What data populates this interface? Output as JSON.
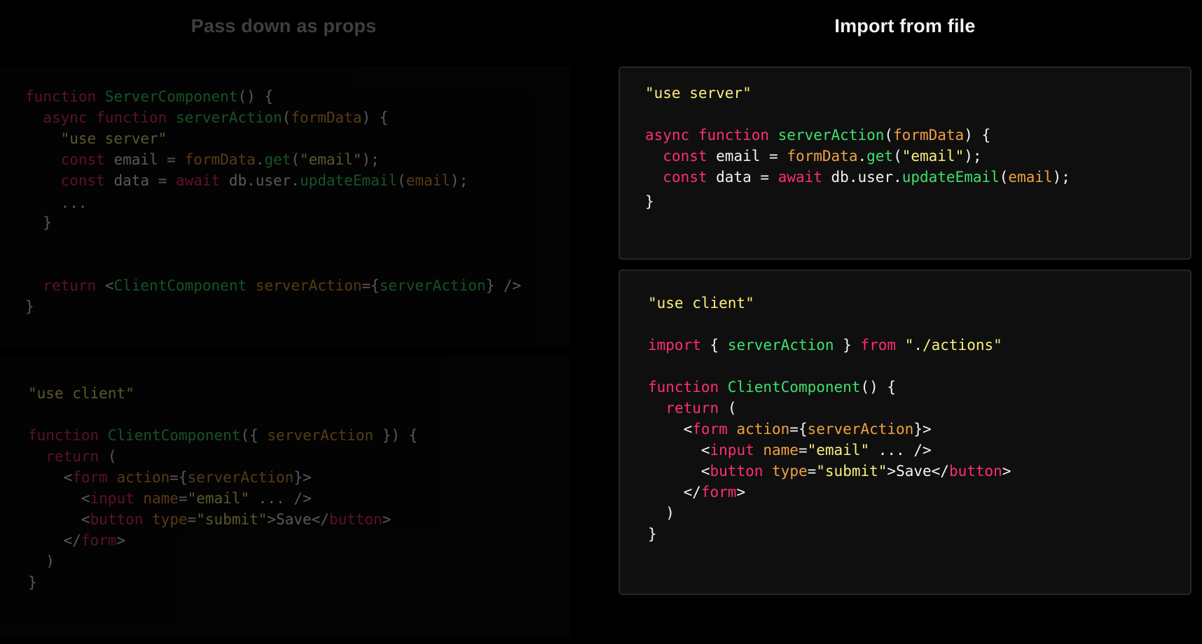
{
  "headings": {
    "left": "Pass down as props",
    "right": "Import from file"
  },
  "panels": {
    "left_server": {
      "lines": [
        [
          [
            "kw",
            "function "
          ],
          [
            "fn",
            "ServerComponent"
          ],
          [
            "pl",
            "() {"
          ]
        ],
        [
          [
            "pl",
            "  "
          ],
          [
            "kw",
            "async function "
          ],
          [
            "fn",
            "serverAction"
          ],
          [
            "pl",
            "("
          ],
          [
            "prm",
            "formData"
          ],
          [
            "pl",
            ") {"
          ]
        ],
        [
          [
            "pl",
            "    "
          ],
          [
            "str",
            "\"use server\""
          ]
        ],
        [
          [
            "pl",
            "    "
          ],
          [
            "kw",
            "const "
          ],
          [
            "pl",
            "email = "
          ],
          [
            "prm",
            "formData"
          ],
          [
            "pl",
            "."
          ],
          [
            "fn",
            "get"
          ],
          [
            "pl",
            "("
          ],
          [
            "str",
            "\"email\""
          ],
          [
            "pl",
            ");"
          ]
        ],
        [
          [
            "pl",
            "    "
          ],
          [
            "kw",
            "const "
          ],
          [
            "pl",
            "data = "
          ],
          [
            "kw",
            "await "
          ],
          [
            "pl",
            "db.user."
          ],
          [
            "fn",
            "updateEmail"
          ],
          [
            "pl",
            "("
          ],
          [
            "prm",
            "email"
          ],
          [
            "pl",
            ");"
          ]
        ],
        [
          [
            "pl",
            "    ..."
          ]
        ],
        [
          [
            "pl",
            "  }"
          ]
        ],
        [
          [
            "pl",
            ""
          ]
        ],
        [
          [
            "pl",
            "  "
          ],
          [
            "kw",
            "return "
          ],
          [
            "pl",
            "<"
          ],
          [
            "fn",
            "ClientComponent "
          ],
          [
            "prm",
            "serverAction"
          ],
          [
            "pl",
            "={"
          ],
          [
            "fn",
            "serverAction"
          ],
          [
            "pl",
            "} />"
          ]
        ],
        [
          [
            "pl",
            "}"
          ]
        ]
      ]
    },
    "left_client": {
      "lines": [
        [
          [
            "str",
            "\"use client\""
          ]
        ],
        [
          [
            "pl",
            ""
          ]
        ],
        [
          [
            "kw",
            "function "
          ],
          [
            "fn",
            "ClientComponent"
          ],
          [
            "pl",
            "({ "
          ],
          [
            "prm",
            "serverAction"
          ],
          [
            "pl",
            " }) {"
          ]
        ],
        [
          [
            "pl",
            "  "
          ],
          [
            "kw",
            "return "
          ],
          [
            "pl",
            "("
          ]
        ],
        [
          [
            "pl",
            "    <"
          ],
          [
            "kw",
            "form "
          ],
          [
            "prm",
            "action"
          ],
          [
            "pl",
            "={"
          ],
          [
            "prm",
            "serverAction"
          ],
          [
            "pl",
            "}>"
          ]
        ],
        [
          [
            "pl",
            "      <"
          ],
          [
            "kw",
            "input "
          ],
          [
            "prm",
            "name"
          ],
          [
            "pl",
            "="
          ],
          [
            "str",
            "\"email\""
          ],
          [
            "pl",
            " ... />"
          ]
        ],
        [
          [
            "pl",
            "      <"
          ],
          [
            "kw",
            "button "
          ],
          [
            "prm",
            "type"
          ],
          [
            "pl",
            "="
          ],
          [
            "str",
            "\"submit\""
          ],
          [
            "pl",
            ">Save</"
          ],
          [
            "kw",
            "button"
          ],
          [
            "pl",
            ">"
          ]
        ],
        [
          [
            "pl",
            "    </"
          ],
          [
            "kw",
            "form"
          ],
          [
            "pl",
            ">"
          ]
        ],
        [
          [
            "pl",
            "  )"
          ]
        ],
        [
          [
            "pl",
            "}"
          ]
        ]
      ]
    },
    "right_server": {
      "lines": [
        [
          [
            "str",
            "\"use server\""
          ]
        ],
        [
          [
            "pl",
            ""
          ]
        ],
        [
          [
            "kw",
            "async function "
          ],
          [
            "fn",
            "serverAction"
          ],
          [
            "pl",
            "("
          ],
          [
            "prm",
            "formData"
          ],
          [
            "pl",
            ") {"
          ]
        ],
        [
          [
            "pl",
            "  "
          ],
          [
            "kw",
            "const "
          ],
          [
            "pl",
            "email = "
          ],
          [
            "prm",
            "formData"
          ],
          [
            "pl",
            "."
          ],
          [
            "fn",
            "get"
          ],
          [
            "pl",
            "("
          ],
          [
            "str",
            "\"email\""
          ],
          [
            "pl",
            ");"
          ]
        ],
        [
          [
            "pl",
            "  "
          ],
          [
            "kw",
            "const "
          ],
          [
            "pl",
            "data = "
          ],
          [
            "kw",
            "await "
          ],
          [
            "pl",
            "db.user."
          ],
          [
            "fn",
            "updateEmail"
          ],
          [
            "pl",
            "("
          ],
          [
            "prm",
            "email"
          ],
          [
            "pl",
            ");"
          ]
        ],
        [
          [
            "pl",
            "}"
          ]
        ]
      ]
    },
    "right_client": {
      "lines": [
        [
          [
            "str",
            "\"use client\""
          ]
        ],
        [
          [
            "pl",
            ""
          ]
        ],
        [
          [
            "kw",
            "import "
          ],
          [
            "pl",
            "{ "
          ],
          [
            "fn",
            "serverAction"
          ],
          [
            "pl",
            " } "
          ],
          [
            "kw",
            "from "
          ],
          [
            "str",
            "\"./actions\""
          ]
        ],
        [
          [
            "pl",
            ""
          ]
        ],
        [
          [
            "kw",
            "function "
          ],
          [
            "fn",
            "ClientComponent"
          ],
          [
            "pl",
            "() {"
          ]
        ],
        [
          [
            "pl",
            "  "
          ],
          [
            "kw",
            "return "
          ],
          [
            "pl",
            "("
          ]
        ],
        [
          [
            "pl",
            "    <"
          ],
          [
            "kw",
            "form "
          ],
          [
            "prm",
            "action"
          ],
          [
            "pl",
            "={"
          ],
          [
            "prm",
            "serverAction"
          ],
          [
            "pl",
            "}>"
          ]
        ],
        [
          [
            "pl",
            "      <"
          ],
          [
            "kw",
            "input "
          ],
          [
            "prm",
            "name"
          ],
          [
            "pl",
            "="
          ],
          [
            "str",
            "\"email\""
          ],
          [
            "pl",
            " ... />"
          ]
        ],
        [
          [
            "pl",
            "      <"
          ],
          [
            "kw",
            "button "
          ],
          [
            "prm",
            "type"
          ],
          [
            "pl",
            "="
          ],
          [
            "str",
            "\"submit\""
          ],
          [
            "pl",
            ">Save</"
          ],
          [
            "kw",
            "button"
          ],
          [
            "pl",
            ">"
          ]
        ],
        [
          [
            "pl",
            "    </"
          ],
          [
            "kw",
            "form"
          ],
          [
            "pl",
            ">"
          ]
        ],
        [
          [
            "pl",
            "  )"
          ]
        ],
        [
          [
            "pl",
            "}"
          ]
        ]
      ]
    }
  }
}
